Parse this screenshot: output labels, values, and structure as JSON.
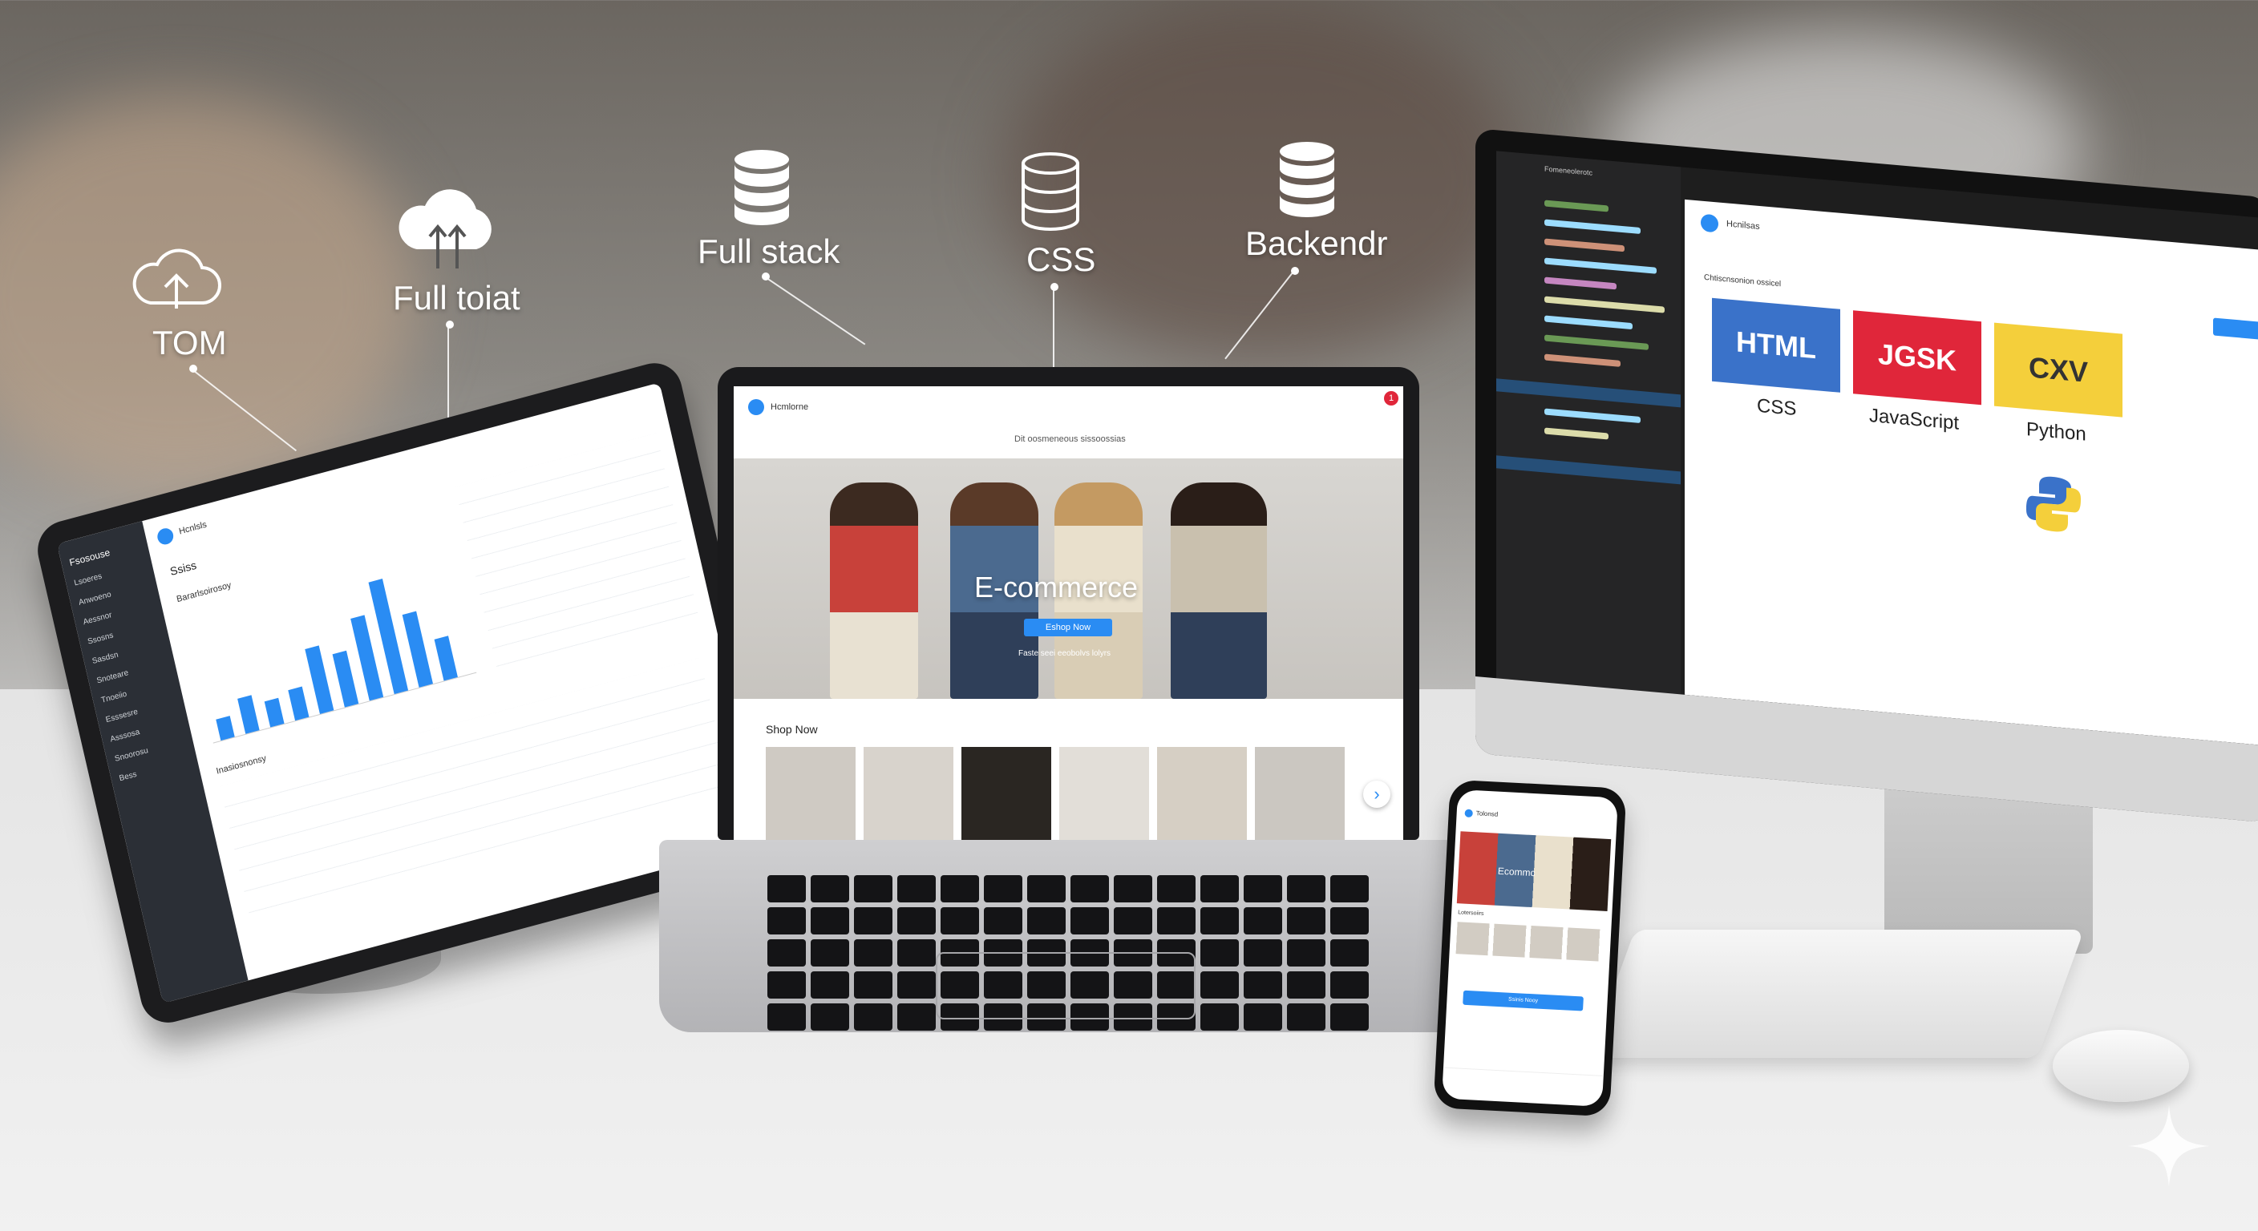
{
  "labels": {
    "cloud_left": "TOM",
    "cloud_right": "Full toiat",
    "db_left": "Full stack",
    "db_mid": "CSS",
    "db_right": "Backendr"
  },
  "icons": [
    "cloud-upload-icon",
    "cloud-upload-icon",
    "database-icon",
    "database-icon",
    "database-icon"
  ],
  "tablet": {
    "title": "Hcnlsls",
    "section": "Ssiss",
    "chart_title": "Bararlsoirosoy",
    "table_title": "Inasiosnonsy",
    "sidebar_title": "Fsosouse",
    "sidebar_items": [
      "Lsoeres",
      "Anwoeno",
      "Aessnor",
      "Ssosns",
      "Sasdsn",
      "Snoteare",
      "Tnoeiio",
      "Esssesre",
      "Asssosa",
      "Snoorosu",
      "Bess"
    ],
    "bars": [
      0.18,
      0.3,
      0.22,
      0.26,
      0.55,
      0.45,
      0.7,
      0.95,
      0.62,
      0.35
    ]
  },
  "laptop": {
    "brand": "Hcmlorne",
    "promo": "Dit oosmeneous sissoossias",
    "hero_title": "E-commerce",
    "cta_label": "Eshop Now",
    "hero_sub": "Faste seei eeobolvs lolyrs",
    "section_title": "Shop Now",
    "badge_count": "1"
  },
  "monitor": {
    "tab_title": "Fomeneolerotc",
    "app_title": "Hcnilsas",
    "breadcrumb": "Chtiscnsonion ossicel",
    "tiles": [
      {
        "label": "HTML",
        "caption": "CSS",
        "color": "#3a72c9"
      },
      {
        "label": "JGSK",
        "caption": "JavaScript",
        "color": "#e0263a"
      },
      {
        "label": "CXV",
        "caption": "Python",
        "color": "#f4cf3b"
      }
    ]
  },
  "phone": {
    "brand": "Tolonsd",
    "hero_title": "Ecommc",
    "section": "Lotersoiirs",
    "cta": "Ssinis Nooy"
  },
  "colors": {
    "accent": "#2a8cf3",
    "dark": "#1a1a1c"
  }
}
